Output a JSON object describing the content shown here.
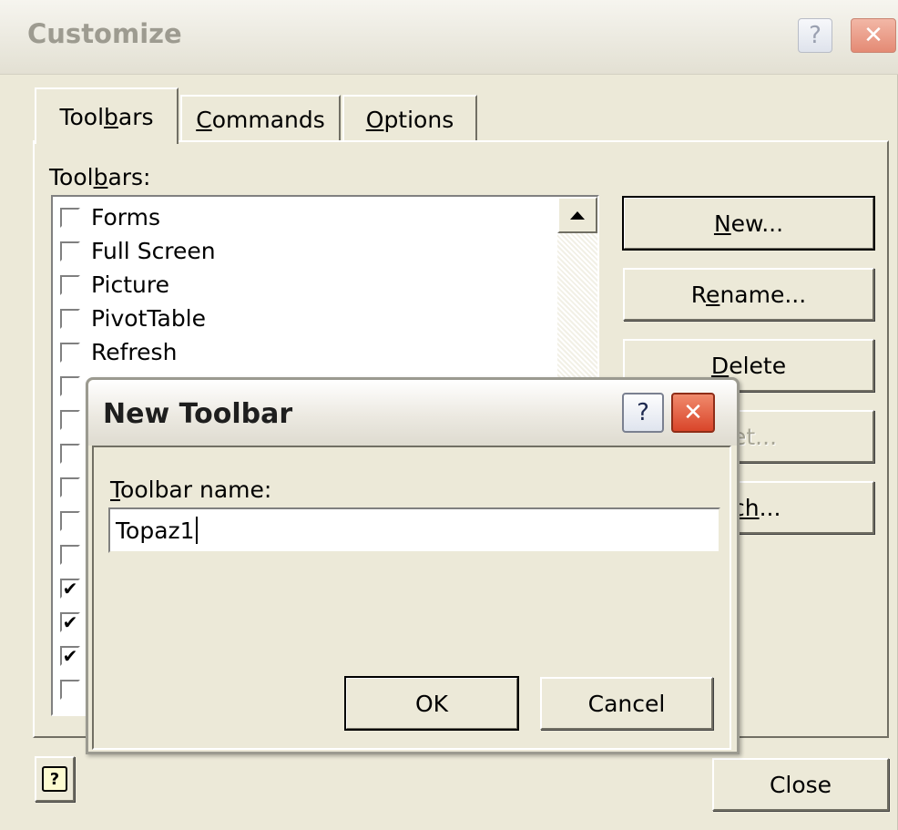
{
  "outer": {
    "title": "Customize",
    "help_glyph": "?",
    "close_glyph": "✕",
    "tabs": [
      {
        "pre": "Tool",
        "u": "b",
        "post": "ars",
        "active": true
      },
      {
        "pre": "",
        "u": "C",
        "post": "ommands",
        "active": false
      },
      {
        "pre": "",
        "u": "O",
        "post": "ptions",
        "active": false
      }
    ],
    "list_label": {
      "pre": "Tool",
      "u": "b",
      "post": "ars:"
    },
    "toolbar_items": [
      {
        "label": "Forms",
        "checked": false
      },
      {
        "label": "Full Screen",
        "checked": false
      },
      {
        "label": "Picture",
        "checked": false
      },
      {
        "label": "PivotTable",
        "checked": false
      },
      {
        "label": "Refresh",
        "checked": false
      },
      {
        "label": "",
        "checked": false
      },
      {
        "label": "",
        "checked": false
      },
      {
        "label": "",
        "checked": false
      },
      {
        "label": "",
        "checked": false
      },
      {
        "label": "",
        "checked": false
      },
      {
        "label": "",
        "checked": false
      },
      {
        "label": "",
        "checked": true
      },
      {
        "label": "",
        "checked": true
      },
      {
        "label": "",
        "checked": true
      },
      {
        "label": "",
        "checked": false
      }
    ],
    "buttons": {
      "new": {
        "pre": "",
        "u": "N",
        "post": "ew..."
      },
      "rename": {
        "pre": "R",
        "u": "e",
        "post": "name..."
      },
      "delete": {
        "pre": "",
        "u": "D",
        "post": "elete"
      },
      "reset_fragment": "et...",
      "attach_fragment_u": "ch",
      "attach_fragment_post": "..."
    },
    "close_label": "Close",
    "help_icon_glyph": "?"
  },
  "dialog": {
    "title": "New Toolbar",
    "help_glyph": "?",
    "close_glyph": "✕",
    "field_label": {
      "pre": "",
      "u": "T",
      "post": "oolbar name:"
    },
    "field_value": "Topaz1",
    "ok_label": "OK",
    "cancel_label": "Cancel"
  },
  "colors": {
    "face": "#ece9d8",
    "close_red": "#d9452a",
    "help_blue": "#e9eef8"
  }
}
